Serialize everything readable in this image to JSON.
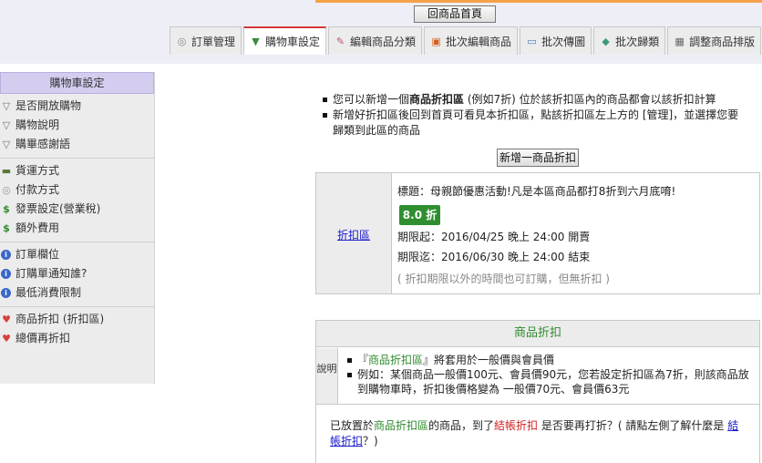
{
  "header": {
    "home_button": "回商品首頁",
    "tabs": [
      {
        "label": "訂單管理",
        "icon": "coin-icon",
        "active": false
      },
      {
        "label": "購物車設定",
        "icon": "cart-icon",
        "active": true
      },
      {
        "label": "編輯商品分類",
        "icon": "pencil-icon",
        "active": false
      },
      {
        "label": "批次編輯商品",
        "icon": "gift-icon",
        "active": false
      },
      {
        "label": "批次傳圖",
        "icon": "monitor-icon",
        "active": false
      },
      {
        "label": "批次歸類",
        "icon": "tag-icon",
        "active": false
      },
      {
        "label": "調整商品排版",
        "icon": "grid-icon",
        "active": false
      }
    ]
  },
  "sidebar": {
    "title": "購物車設定",
    "groups": [
      {
        "items": [
          {
            "label": "是否開放購物",
            "icon": "cart-icon"
          },
          {
            "label": "購物說明",
            "icon": "cart-icon"
          },
          {
            "label": "購畢感謝語",
            "icon": "cart-icon"
          }
        ]
      },
      {
        "items": [
          {
            "label": "貨運方式",
            "icon": "truck-icon"
          },
          {
            "label": "付款方式",
            "icon": "coin-icon"
          },
          {
            "label": "發票設定(營業稅)",
            "icon": "dollar-icon"
          },
          {
            "label": "額外費用",
            "icon": "dollar-icon"
          }
        ]
      },
      {
        "items": [
          {
            "label": "訂單欄位",
            "icon": "info-icon"
          },
          {
            "label": "訂購單通知誰?",
            "icon": "info-icon"
          },
          {
            "label": "最低消費限制",
            "icon": "info-icon"
          }
        ]
      },
      {
        "items": [
          {
            "label": "商品折扣 (折扣區)",
            "icon": "heart-icon"
          },
          {
            "label": "總價再折扣",
            "icon": "heart-icon"
          }
        ]
      }
    ]
  },
  "notes": {
    "line1_pre": "您可以新增一個",
    "line1_bold": "商品折扣區",
    "line1_post": " (例如7折) 位於該折扣區內的商品都會以該折扣計算",
    "line2": "新增好折扣區後回到首頁可看見本折扣區，點該折扣區左上方的 [管理]，並選擇您要歸類到此區的商品"
  },
  "add_button": "新增一商品折扣",
  "zone": {
    "link": "折扣區",
    "title": "標題：母親節優惠活動!凡是本區商品都打8折到六月底唷!",
    "badge": "8.0 折",
    "start": "期限起：2016/04/25 晚上 24:00 開賣",
    "end": "期限迄：2016/06/30 晚上 24:00 結束",
    "note": "( 折扣期限以外的時間也可訂購，但無折扣 )"
  },
  "product_discount": {
    "header": "商品折扣",
    "label": "說明",
    "item1_pre": "『",
    "item1_green": "商品折扣區",
    "item1_post": "』將套用於一般價與會員價",
    "item2": "例如：某個商品一般價100元、會員價90元，您若設定折扣區為7折，則該商品放到購物車時，折扣後價格變為 一般價70元、會員價63元",
    "q_pre": "已放置於",
    "q_green": "商品折扣區",
    "q_mid": "的商品，到了",
    "q_red": "結帳折扣",
    "q_post": " 是否要再打折？( 請點左側了解什麼是 ",
    "q_link": "結帳折扣",
    "q_end": "？)"
  },
  "colors": {
    "accent_red": "#d23a3a",
    "badge_green": "#2f8e2f",
    "sidebar_title_bg": "#d4cdf0",
    "link_blue": "#1a1acc",
    "top_rule": "#f4a24a"
  }
}
